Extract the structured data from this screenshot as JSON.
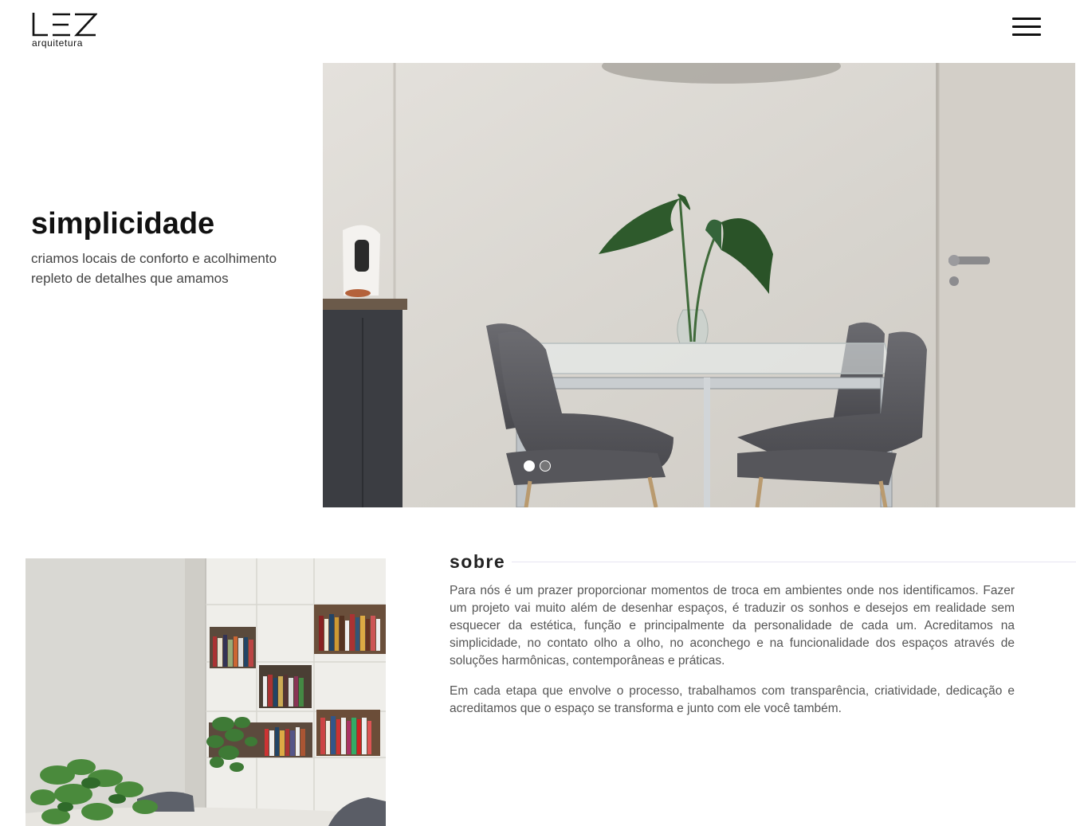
{
  "header": {
    "logo_mark": "LEZ",
    "logo_sub": "arquitetura",
    "menu_icon": "hamburger-menu-icon"
  },
  "hero": {
    "title": "simplicidade",
    "subtitle_line1": "criamos locais de conforto e acolhimento",
    "subtitle_line2": "repleto de detalhes que amamos",
    "slides_total": 2,
    "active_slide": 1
  },
  "about": {
    "title": "sobre",
    "paragraph1": "Para nós é um prazer proporcionar momentos de troca em ambientes onde nos identificamos. Fazer um projeto vai muito além de desenhar espaços, é traduzir os sonhos e desejos em realidade sem esquecer da estética, função e principalmente da personalidade de cada um. Acreditamos na simplicidade, no contato olho a olho, no aconchego e na funcionalidade dos espaços através de soluções harmônicas, contemporâneas e práticas.",
    "paragraph2": "Em cada etapa que envolve o processo, trabalhamos com transparência, criatividade, dedicação e acreditamos que o espaço se transforma e junto com ele você também."
  },
  "colors": {
    "background": "#ffffff",
    "text_dark": "#111111",
    "text_body": "#555555",
    "divider": "#e6e4f2"
  }
}
